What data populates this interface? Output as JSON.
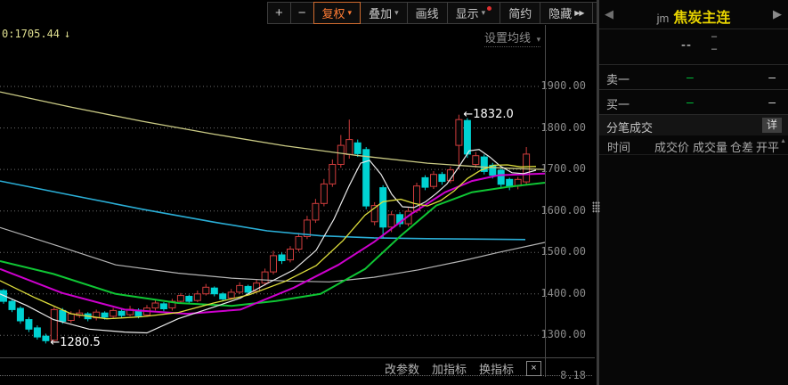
{
  "toolbar": {
    "zoom_in": "+",
    "zoom_out": "−",
    "fuquan": "复权",
    "overlay": "叠加",
    "draw": "画线",
    "display": "显示",
    "simple": "简约",
    "hide": "隐藏",
    "hide_arrows": "▶▶",
    "caret": "▾"
  },
  "chart": {
    "ma_label_value": "0:1705.44",
    "ma_label_arrow": "↓",
    "ma_settings_label": "设置均线",
    "ma_settings_caret": "▾",
    "bottom_links": {
      "change_params": "改参数",
      "add_indicator": "加指标",
      "switch_indicator": "换指标",
      "close": "×"
    },
    "sub_axis_value": "8.18"
  },
  "right_panel": {
    "prev_arrow": "◀",
    "next_arrow": "▶",
    "symbol_code": "jm",
    "symbol_name": "焦炭主连",
    "last_price": "--",
    "change_dash1": "–",
    "change_dash2": "–",
    "rows": [
      {
        "label": "卖一",
        "price": "–",
        "vol": "–"
      },
      {
        "label": "买一",
        "price": "–",
        "vol": "–"
      }
    ],
    "tick_title": "分笔成交",
    "detail_button": "详",
    "table_headers": [
      "时间",
      "成交价",
      "成交量",
      "仓差",
      "开平"
    ],
    "scroll_arrow": "▲"
  },
  "chart_data": {
    "type": "candlestick",
    "title": "jm 焦炭主连",
    "up_color": "#d03c3c",
    "down_color": "#00d2d2",
    "grid_color": "#6e6e6e",
    "y_axis": {
      "ticks": [
        "1900.00",
        "1800.00",
        "1700.00",
        "1600.00",
        "1500.00",
        "1400.00",
        "1300.00"
      ],
      "min": 1260,
      "max": 1950
    },
    "annotations": [
      {
        "label": "←1832.0",
        "candle_index": 54,
        "price": 1832
      },
      {
        "label": "←1280.5",
        "candle_index": 5,
        "price": 1280.5
      }
    ],
    "candles_ohlc": [
      [
        1408,
        1382,
        1412,
        1376
      ],
      [
        1382,
        1362,
        1386,
        1356
      ],
      [
        1365,
        1335,
        1370,
        1328
      ],
      [
        1338,
        1315,
        1344,
        1308
      ],
      [
        1318,
        1296,
        1324,
        1290
      ],
      [
        1298,
        1287,
        1304,
        1280.5
      ],
      [
        1288,
        1362,
        1368,
        1282
      ],
      [
        1360,
        1334,
        1366,
        1328
      ],
      [
        1336,
        1352,
        1358,
        1330
      ],
      [
        1348,
        1354,
        1362,
        1342
      ],
      [
        1352,
        1340,
        1356,
        1334
      ],
      [
        1342,
        1356,
        1362,
        1336
      ],
      [
        1354,
        1344,
        1358,
        1338
      ],
      [
        1346,
        1360,
        1366,
        1340
      ],
      [
        1358,
        1348,
        1364,
        1342
      ],
      [
        1350,
        1363,
        1371,
        1346
      ],
      [
        1361,
        1347,
        1365,
        1341
      ],
      [
        1349,
        1366,
        1373,
        1345
      ],
      [
        1366,
        1378,
        1385,
        1360
      ],
      [
        1376,
        1364,
        1380,
        1358
      ],
      [
        1366,
        1382,
        1388,
        1360
      ],
      [
        1382,
        1396,
        1402,
        1376
      ],
      [
        1394,
        1382,
        1398,
        1376
      ],
      [
        1384,
        1400,
        1408,
        1380
      ],
      [
        1400,
        1416,
        1424,
        1396
      ],
      [
        1414,
        1400,
        1418,
        1394
      ],
      [
        1400,
        1388,
        1404,
        1382
      ],
      [
        1390,
        1404,
        1412,
        1386
      ],
      [
        1404,
        1420,
        1428,
        1400
      ],
      [
        1418,
        1404,
        1422,
        1398
      ],
      [
        1406,
        1426,
        1434,
        1402
      ],
      [
        1426,
        1453,
        1461,
        1420
      ],
      [
        1453,
        1492,
        1504,
        1447
      ],
      [
        1494,
        1480,
        1500,
        1472
      ],
      [
        1482,
        1508,
        1515,
        1476
      ],
      [
        1508,
        1538,
        1547,
        1502
      ],
      [
        1538,
        1578,
        1588,
        1532
      ],
      [
        1578,
        1618,
        1629,
        1571
      ],
      [
        1618,
        1665,
        1677,
        1611
      ],
      [
        1665,
        1712,
        1724,
        1658
      ],
      [
        1712,
        1758,
        1783,
        1704
      ],
      [
        1736,
        1772,
        1820,
        1726
      ],
      [
        1764,
        1738,
        1772,
        1730
      ],
      [
        1748,
        1612,
        1754,
        1604
      ],
      [
        1574,
        1613,
        1621,
        1565
      ],
      [
        1656,
        1561,
        1662,
        1534
      ],
      [
        1561,
        1591,
        1599,
        1549
      ],
      [
        1591,
        1569,
        1597,
        1561
      ],
      [
        1569,
        1599,
        1607,
        1563
      ],
      [
        1601,
        1660,
        1668,
        1595
      ],
      [
        1680,
        1657,
        1686,
        1650
      ],
      [
        1659,
        1688,
        1696,
        1653
      ],
      [
        1688,
        1671,
        1694,
        1663
      ],
      [
        1673,
        1699,
        1707,
        1667
      ],
      [
        1758,
        1820,
        1832,
        1700
      ],
      [
        1818,
        1737,
        1824,
        1728
      ],
      [
        1712,
        1733,
        1742,
        1704
      ],
      [
        1730,
        1695,
        1736,
        1688
      ],
      [
        1710,
        1686,
        1716,
        1678
      ],
      [
        1698,
        1664,
        1704,
        1656
      ],
      [
        1676,
        1658,
        1680,
        1650
      ],
      [
        1660,
        1676,
        1682,
        1652
      ],
      [
        1670,
        1737,
        1754,
        1662
      ]
    ],
    "ma_series": [
      {
        "name": "ma-slow-yellow",
        "color": "#cbcb85",
        "width": 1.3,
        "points": [
          [
            0,
            1887
          ],
          [
            80,
            1850
          ],
          [
            160,
            1816
          ],
          [
            240,
            1785
          ],
          [
            320,
            1757
          ],
          [
            400,
            1734
          ],
          [
            480,
            1715
          ],
          [
            540,
            1706
          ],
          [
            580,
            1702
          ],
          [
            612,
            1700
          ]
        ]
      },
      {
        "name": "ma-cyan",
        "color": "#2aaed6",
        "width": 1.6,
        "points": [
          [
            0,
            1672
          ],
          [
            80,
            1638
          ],
          [
            160,
            1604
          ],
          [
            240,
            1573
          ],
          [
            300,
            1552
          ],
          [
            360,
            1540
          ],
          [
            420,
            1535
          ],
          [
            480,
            1533
          ],
          [
            540,
            1532
          ],
          [
            590,
            1531
          ]
        ]
      },
      {
        "name": "ma-gray",
        "color": "#b5b5b5",
        "width": 1.2,
        "points": [
          [
            0,
            1560
          ],
          [
            70,
            1512
          ],
          [
            130,
            1470
          ],
          [
            200,
            1450
          ],
          [
            260,
            1438
          ],
          [
            320,
            1431
          ],
          [
            370,
            1429
          ],
          [
            420,
            1440
          ],
          [
            470,
            1458
          ],
          [
            520,
            1480
          ],
          [
            560,
            1500
          ],
          [
            612,
            1524
          ]
        ]
      },
      {
        "name": "ma-green",
        "color": "#0fc634",
        "width": 2,
        "points": [
          [
            0,
            1479
          ],
          [
            60,
            1448
          ],
          [
            130,
            1400
          ],
          [
            200,
            1378
          ],
          [
            260,
            1371
          ],
          [
            310,
            1383
          ],
          [
            360,
            1400
          ],
          [
            410,
            1460
          ],
          [
            450,
            1540
          ],
          [
            490,
            1613
          ],
          [
            530,
            1645
          ],
          [
            570,
            1658
          ],
          [
            612,
            1668
          ]
        ]
      },
      {
        "name": "ma-magenta",
        "color": "#cd00cd",
        "width": 2,
        "points": [
          [
            0,
            1460
          ],
          [
            70,
            1402
          ],
          [
            140,
            1362
          ],
          [
            210,
            1352
          ],
          [
            270,
            1362
          ],
          [
            330,
            1415
          ],
          [
            380,
            1470
          ],
          [
            420,
            1525
          ],
          [
            460,
            1590
          ],
          [
            500,
            1645
          ],
          [
            530,
            1672
          ],
          [
            560,
            1686
          ],
          [
            612,
            1690
          ]
        ]
      },
      {
        "name": "ma-fast-white",
        "color": "#ececec",
        "width": 1.2,
        "points": [
          [
            0,
            1400
          ],
          [
            30,
            1372
          ],
          [
            60,
            1338
          ],
          [
            100,
            1315
          ],
          [
            140,
            1308
          ],
          [
            165,
            1306
          ],
          [
            200,
            1340
          ],
          [
            240,
            1368
          ],
          [
            270,
            1390
          ],
          [
            300,
            1425
          ],
          [
            330,
            1458
          ],
          [
            355,
            1505
          ],
          [
            375,
            1580
          ],
          [
            392,
            1660
          ],
          [
            405,
            1715
          ],
          [
            415,
            1722
          ],
          [
            428,
            1688
          ],
          [
            440,
            1640
          ],
          [
            452,
            1610
          ],
          [
            465,
            1608
          ],
          [
            478,
            1622
          ],
          [
            490,
            1642
          ],
          [
            502,
            1665
          ],
          [
            515,
            1705
          ],
          [
            527,
            1745
          ],
          [
            538,
            1748
          ],
          [
            550,
            1730
          ],
          [
            562,
            1708
          ],
          [
            575,
            1692
          ],
          [
            588,
            1690
          ],
          [
            602,
            1698
          ]
        ]
      },
      {
        "name": "ma-fast-yellow",
        "color": "#dede3c",
        "width": 1.3,
        "points": [
          [
            0,
            1432
          ],
          [
            40,
            1390
          ],
          [
            80,
            1352
          ],
          [
            120,
            1340
          ],
          [
            160,
            1345
          ],
          [
            200,
            1355
          ],
          [
            240,
            1378
          ],
          [
            280,
            1398
          ],
          [
            320,
            1430
          ],
          [
            355,
            1468
          ],
          [
            385,
            1528
          ],
          [
            410,
            1590
          ],
          [
            430,
            1622
          ],
          [
            450,
            1628
          ],
          [
            465,
            1618
          ],
          [
            480,
            1612
          ],
          [
            495,
            1625
          ],
          [
            510,
            1648
          ],
          [
            525,
            1678
          ],
          [
            540,
            1698
          ],
          [
            555,
            1710
          ],
          [
            570,
            1711
          ],
          [
            585,
            1706
          ],
          [
            602,
            1707
          ]
        ]
      }
    ]
  }
}
